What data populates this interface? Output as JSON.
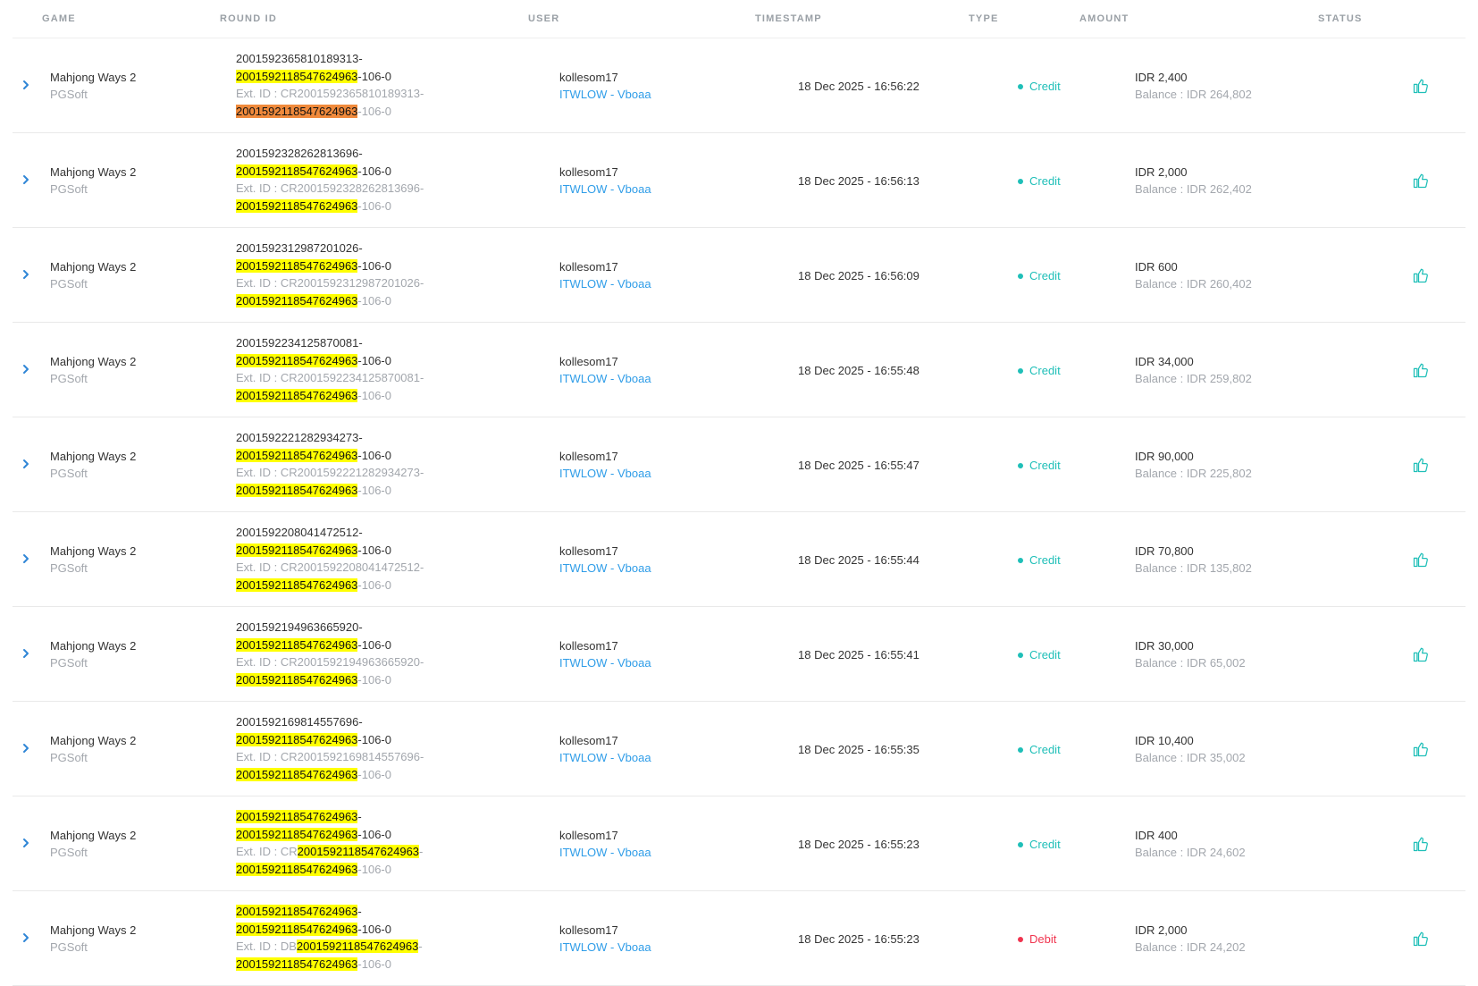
{
  "headers": {
    "game": "GAME",
    "round_id": "ROUND ID",
    "user": "USER",
    "timestamp": "TIMESTAMP",
    "type": "TYPE",
    "amount": "AMOUNT",
    "status": "STATUS"
  },
  "colors": {
    "highlight": "#ffff00",
    "highlight_current": "#f08a3c",
    "credit": "#1fbfb8",
    "debit": "#f0344f",
    "link": "#2f9de8",
    "status_icon": "#1fbfb8"
  },
  "icons": {
    "expand": "chevron-right-icon",
    "status": "thumbs-up-icon"
  },
  "rows": [
    {
      "game": "Mahjong Ways 2",
      "provider": "PGSoft",
      "round": {
        "line1": [
          {
            "t": "2001592365810189313-",
            "h": ""
          }
        ],
        "line2": [
          {
            "t": "2001592118547624963",
            "h": "y"
          },
          {
            "t": "-106-0",
            "h": ""
          }
        ],
        "line3": [
          {
            "t": "Ext. ID : CR2001592365810189313-",
            "h": ""
          }
        ],
        "line4": [
          {
            "t": "2001592118547624963",
            "h": "o"
          },
          {
            "t": "-106-0",
            "h": ""
          }
        ]
      },
      "user": "kollesom17",
      "agent": "ITWLOW - Vboaa",
      "timestamp": "18 Dec 2025 - 16:56:22",
      "type": "Credit",
      "amount": "IDR 2,400",
      "balance": "Balance : IDR 264,802"
    },
    {
      "game": "Mahjong Ways 2",
      "provider": "PGSoft",
      "round": {
        "line1": [
          {
            "t": "2001592328262813696-",
            "h": ""
          }
        ],
        "line2": [
          {
            "t": "2001592118547624963",
            "h": "y"
          },
          {
            "t": "-106-0",
            "h": ""
          }
        ],
        "line3": [
          {
            "t": "Ext. ID : CR2001592328262813696-",
            "h": ""
          }
        ],
        "line4": [
          {
            "t": "2001592118547624963",
            "h": "y"
          },
          {
            "t": "-106-0",
            "h": ""
          }
        ]
      },
      "user": "kollesom17",
      "agent": "ITWLOW - Vboaa",
      "timestamp": "18 Dec 2025 - 16:56:13",
      "type": "Credit",
      "amount": "IDR 2,000",
      "balance": "Balance : IDR 262,402"
    },
    {
      "game": "Mahjong Ways 2",
      "provider": "PGSoft",
      "round": {
        "line1": [
          {
            "t": "2001592312987201026-",
            "h": ""
          }
        ],
        "line2": [
          {
            "t": "2001592118547624963",
            "h": "y"
          },
          {
            "t": "-106-0",
            "h": ""
          }
        ],
        "line3": [
          {
            "t": "Ext. ID : CR2001592312987201026-",
            "h": ""
          }
        ],
        "line4": [
          {
            "t": "2001592118547624963",
            "h": "y"
          },
          {
            "t": "-106-0",
            "h": ""
          }
        ]
      },
      "user": "kollesom17",
      "agent": "ITWLOW - Vboaa",
      "timestamp": "18 Dec 2025 - 16:56:09",
      "type": "Credit",
      "amount": "IDR 600",
      "balance": "Balance : IDR 260,402"
    },
    {
      "game": "Mahjong Ways 2",
      "provider": "PGSoft",
      "round": {
        "line1": [
          {
            "t": "2001592234125870081-",
            "h": ""
          }
        ],
        "line2": [
          {
            "t": "2001592118547624963",
            "h": "y"
          },
          {
            "t": "-106-0",
            "h": ""
          }
        ],
        "line3": [
          {
            "t": "Ext. ID : CR2001592234125870081-",
            "h": ""
          }
        ],
        "line4": [
          {
            "t": "2001592118547624963",
            "h": "y"
          },
          {
            "t": "-106-0",
            "h": ""
          }
        ]
      },
      "user": "kollesom17",
      "agent": "ITWLOW - Vboaa",
      "timestamp": "18 Dec 2025 - 16:55:48",
      "type": "Credit",
      "amount": "IDR 34,000",
      "balance": "Balance : IDR 259,802"
    },
    {
      "game": "Mahjong Ways 2",
      "provider": "PGSoft",
      "round": {
        "line1": [
          {
            "t": "2001592221282934273-",
            "h": ""
          }
        ],
        "line2": [
          {
            "t": "2001592118547624963",
            "h": "y"
          },
          {
            "t": "-106-0",
            "h": ""
          }
        ],
        "line3": [
          {
            "t": "Ext. ID : CR2001592221282934273-",
            "h": ""
          }
        ],
        "line4": [
          {
            "t": "2001592118547624963",
            "h": "y"
          },
          {
            "t": "-106-0",
            "h": ""
          }
        ]
      },
      "user": "kollesom17",
      "agent": "ITWLOW - Vboaa",
      "timestamp": "18 Dec 2025 - 16:55:47",
      "type": "Credit",
      "amount": "IDR 90,000",
      "balance": "Balance : IDR 225,802"
    },
    {
      "game": "Mahjong Ways 2",
      "provider": "PGSoft",
      "round": {
        "line1": [
          {
            "t": "2001592208041472512-",
            "h": ""
          }
        ],
        "line2": [
          {
            "t": "2001592118547624963",
            "h": "y"
          },
          {
            "t": "-106-0",
            "h": ""
          }
        ],
        "line3": [
          {
            "t": "Ext. ID : CR2001592208041472512-",
            "h": ""
          }
        ],
        "line4": [
          {
            "t": "2001592118547624963",
            "h": "y"
          },
          {
            "t": "-106-0",
            "h": ""
          }
        ]
      },
      "user": "kollesom17",
      "agent": "ITWLOW - Vboaa",
      "timestamp": "18 Dec 2025 - 16:55:44",
      "type": "Credit",
      "amount": "IDR 70,800",
      "balance": "Balance : IDR 135,802"
    },
    {
      "game": "Mahjong Ways 2",
      "provider": "PGSoft",
      "round": {
        "line1": [
          {
            "t": "2001592194963665920-",
            "h": ""
          }
        ],
        "line2": [
          {
            "t": "2001592118547624963",
            "h": "y"
          },
          {
            "t": "-106-0",
            "h": ""
          }
        ],
        "line3": [
          {
            "t": "Ext. ID : CR2001592194963665920-",
            "h": ""
          }
        ],
        "line4": [
          {
            "t": "2001592118547624963",
            "h": "y"
          },
          {
            "t": "-106-0",
            "h": ""
          }
        ]
      },
      "user": "kollesom17",
      "agent": "ITWLOW - Vboaa",
      "timestamp": "18 Dec 2025 - 16:55:41",
      "type": "Credit",
      "amount": "IDR 30,000",
      "balance": "Balance : IDR 65,002"
    },
    {
      "game": "Mahjong Ways 2",
      "provider": "PGSoft",
      "round": {
        "line1": [
          {
            "t": "2001592169814557696-",
            "h": ""
          }
        ],
        "line2": [
          {
            "t": "2001592118547624963",
            "h": "y"
          },
          {
            "t": "-106-0",
            "h": ""
          }
        ],
        "line3": [
          {
            "t": "Ext. ID : CR2001592169814557696-",
            "h": ""
          }
        ],
        "line4": [
          {
            "t": "2001592118547624963",
            "h": "y"
          },
          {
            "t": "-106-0",
            "h": ""
          }
        ]
      },
      "user": "kollesom17",
      "agent": "ITWLOW - Vboaa",
      "timestamp": "18 Dec 2025 - 16:55:35",
      "type": "Credit",
      "amount": "IDR 10,400",
      "balance": "Balance : IDR 35,002"
    },
    {
      "game": "Mahjong Ways 2",
      "provider": "PGSoft",
      "round": {
        "line1": [
          {
            "t": "2001592118547624963",
            "h": "y"
          },
          {
            "t": "-",
            "h": ""
          }
        ],
        "line2": [
          {
            "t": "2001592118547624963",
            "h": "y"
          },
          {
            "t": "-106-0",
            "h": ""
          }
        ],
        "line3": [
          {
            "t": "Ext. ID : CR",
            "h": ""
          },
          {
            "t": "2001592118547624963",
            "h": "y"
          },
          {
            "t": "-",
            "h": ""
          }
        ],
        "line4": [
          {
            "t": "2001592118547624963",
            "h": "y"
          },
          {
            "t": "-106-0",
            "h": ""
          }
        ]
      },
      "user": "kollesom17",
      "agent": "ITWLOW - Vboaa",
      "timestamp": "18 Dec 2025 - 16:55:23",
      "type": "Credit",
      "amount": "IDR 400",
      "balance": "Balance : IDR 24,602"
    },
    {
      "game": "Mahjong Ways 2",
      "provider": "PGSoft",
      "round": {
        "line1": [
          {
            "t": "2001592118547624963",
            "h": "y"
          },
          {
            "t": "-",
            "h": ""
          }
        ],
        "line2": [
          {
            "t": "2001592118547624963",
            "h": "y"
          },
          {
            "t": "-106-0",
            "h": ""
          }
        ],
        "line3": [
          {
            "t": "Ext. ID : DB",
            "h": ""
          },
          {
            "t": "2001592118547624963",
            "h": "y"
          },
          {
            "t": "-",
            "h": ""
          }
        ],
        "line4": [
          {
            "t": "2001592118547624963",
            "h": "y"
          },
          {
            "t": "-106-0",
            "h": ""
          }
        ]
      },
      "user": "kollesom17",
      "agent": "ITWLOW - Vboaa",
      "timestamp": "18 Dec 2025 - 16:55:23",
      "type": "Debit",
      "amount": "IDR 2,000",
      "balance": "Balance : IDR 24,202"
    }
  ]
}
